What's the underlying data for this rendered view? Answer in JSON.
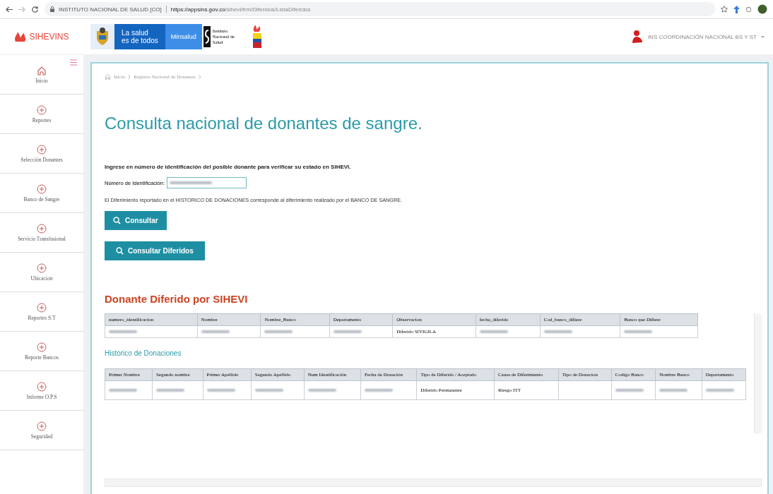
{
  "browser": {
    "site_label": "INSTITUTO NACIONAL DE SALUD [CO]",
    "url_host": "https://appsins.gov.co",
    "url_path": "/sihevi/frm/Diferidos/ListaDiferidos"
  },
  "header": {
    "brand": "SIHEVINS",
    "slogan": [
      "La salud",
      "es de todos"
    ],
    "ministry": "Minsalud",
    "institute": [
      "Instituto",
      "Nacional de",
      "Salud"
    ],
    "user": "INS COORDINACIÓN NACIONAL BS Y ST"
  },
  "sidebar": {
    "items": [
      {
        "label": "Inicio",
        "kind": "home"
      },
      {
        "label": "Reportes",
        "kind": "section"
      },
      {
        "label": "Selección Donantes",
        "kind": "section"
      },
      {
        "label": "Banco de Sangre",
        "kind": "section"
      },
      {
        "label": "Servicio Transfusional",
        "kind": "section"
      },
      {
        "label": "Ubicacion",
        "kind": "section"
      },
      {
        "label": "Reportes S.T",
        "kind": "section"
      },
      {
        "label": "Reporte Bancos",
        "kind": "section"
      },
      {
        "label": "Informe O.P.S",
        "kind": "section"
      },
      {
        "label": "Seguridad",
        "kind": "section"
      }
    ]
  },
  "breadcrumb": [
    "Inicio",
    "Registro Nacional de Donantes"
  ],
  "title": "Consulta nacional de donantes de sangre.",
  "instruction": "Ingrese en número de identificación del posible donante para verificar su estado en SIHEVI.",
  "id_field": {
    "label": "Número de Identificación:",
    "blurred": true
  },
  "note": "El Diferimiento reportado en el HISTORICO DE DONACIONES corresponde al diferimiento realizado por el BANCO DE SANGRE.",
  "buttons": [
    "Consultar",
    "Consultar Diferidos"
  ],
  "sihevi_section": {
    "title": "Donante Diferido por SIHEVI",
    "columns": [
      "numero_identificacion",
      "Nombre",
      "Nombre_Banco",
      "Departamento",
      "Observacion",
      "fecha_diferido",
      "Cod_banco_difiere",
      "Banco que Difiere"
    ],
    "rows": [
      [
        {
          "kind": "blurred"
        },
        {
          "kind": "blurred"
        },
        {
          "kind": "blurred"
        },
        {
          "kind": "blurred"
        },
        {
          "kind": "text",
          "text": "Diferido SIVIGILA"
        },
        {
          "kind": "blurred"
        },
        {
          "kind": "blurred"
        },
        {
          "kind": "blurred"
        }
      ]
    ]
  },
  "history_section": {
    "title": "Historico de Donaciones",
    "columns": [
      "Primer Nombre",
      "Segundo nombre",
      "Primer Apellido",
      "Segundo Apellido",
      "Num Identificación",
      "Fecha de Donación",
      "Tipo de Diferido / Aceptado",
      "Causa de Diferimiento",
      "Tipo de Donacion",
      "Codigo Banco",
      "Nombre Banco",
      "Departamento"
    ],
    "rows": [
      [
        {
          "kind": "blurred"
        },
        {
          "kind": "blurred"
        },
        {
          "kind": "blurred"
        },
        {
          "kind": "blurred"
        },
        {
          "kind": "blurred"
        },
        {
          "kind": "blurred"
        },
        {
          "kind": "text",
          "text": "Diferido Permanente"
        },
        {
          "kind": "text",
          "text": "Riesgo ITT"
        },
        {
          "kind": "empty"
        },
        {
          "kind": "blurred"
        },
        {
          "kind": "blurred"
        },
        {
          "kind": "blurred"
        }
      ]
    ]
  }
}
